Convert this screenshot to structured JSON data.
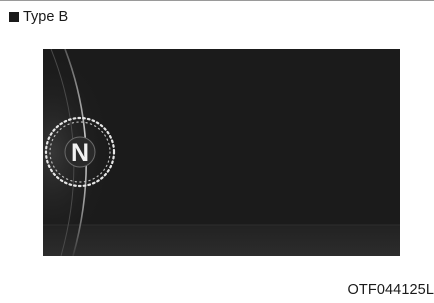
{
  "header": {
    "label": "Type B",
    "bullet_icon": "black-square-icon"
  },
  "display": {
    "gear_indicator": "N",
    "indicator_icon": "dotted-ring-icon",
    "background_color": "#1b1b1b"
  },
  "figure_code": "OTF044125L"
}
